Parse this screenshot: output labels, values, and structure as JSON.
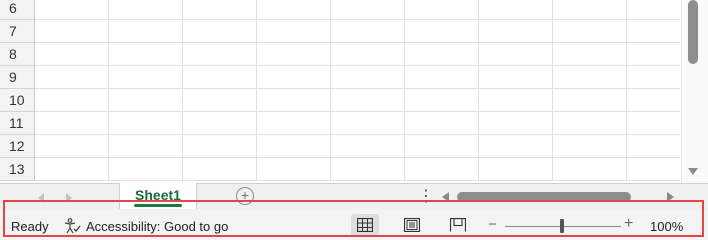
{
  "grid": {
    "row_numbers": [
      "6",
      "7",
      "8",
      "9",
      "10",
      "11",
      "12",
      "13"
    ]
  },
  "tabs": {
    "sheet_name": "Sheet1",
    "add_sheet_symbol": "+",
    "more_symbol": "⋮"
  },
  "status": {
    "mode": "Ready",
    "accessibility": "Accessibility: Good to go",
    "zoom_level": "100%",
    "zoom_minus": "−",
    "zoom_plus": "+"
  },
  "views": {
    "active": "normal",
    "items": [
      "normal",
      "page-layout",
      "page-break-preview"
    ]
  },
  "colors": {
    "sheet_tab_accent": "#1b7a3e",
    "highlight_border": "#e64545"
  }
}
